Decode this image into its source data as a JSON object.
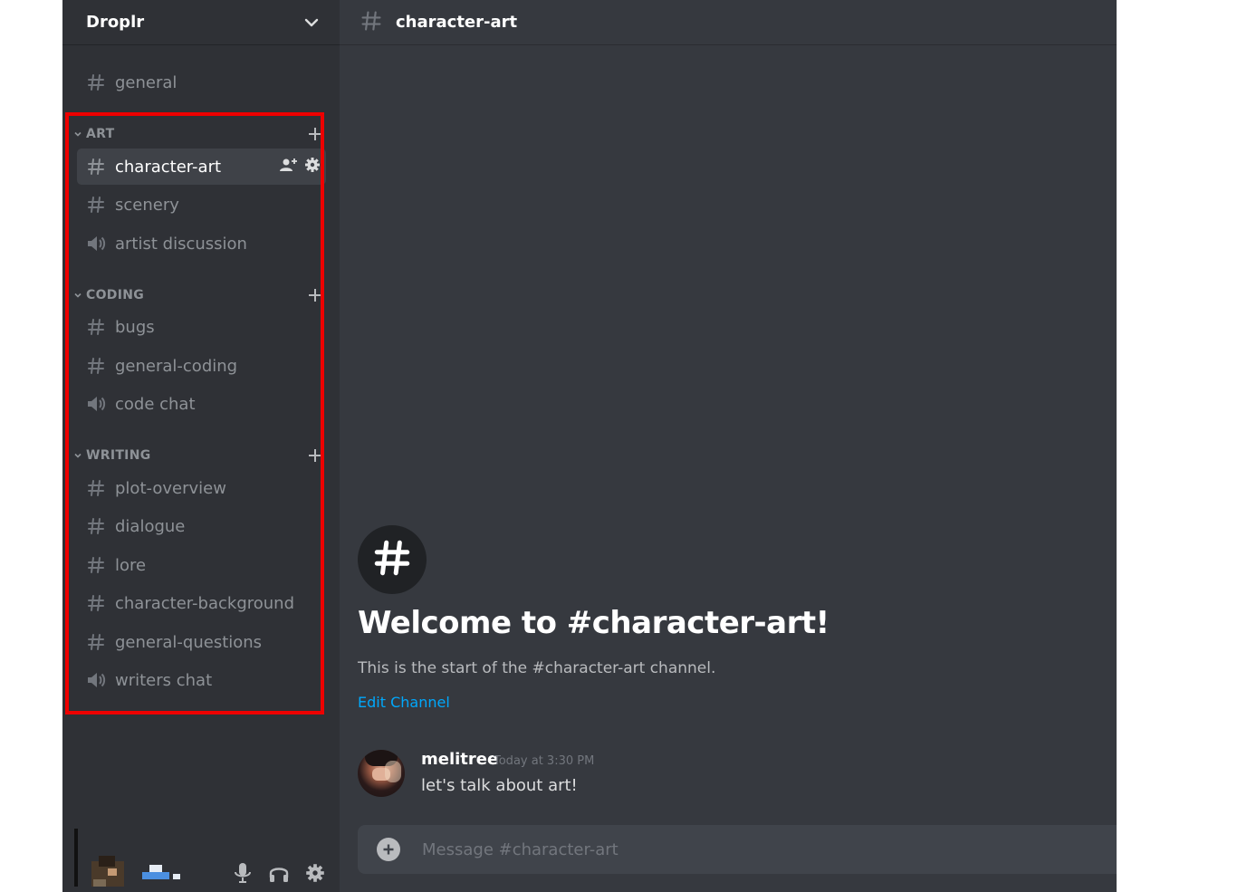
{
  "server": {
    "name": "Droplr"
  },
  "sidebar": {
    "top_channels": [
      {
        "name": "general",
        "type": "text"
      }
    ],
    "categories": [
      {
        "name": "ART",
        "channels": [
          {
            "name": "character-art",
            "type": "text",
            "active": true
          },
          {
            "name": "scenery",
            "type": "text"
          },
          {
            "name": "artist discussion",
            "type": "voice"
          }
        ]
      },
      {
        "name": "CODING",
        "channels": [
          {
            "name": "bugs",
            "type": "text"
          },
          {
            "name": "general-coding",
            "type": "text"
          },
          {
            "name": "code chat",
            "type": "voice"
          }
        ]
      },
      {
        "name": "WRITING",
        "channels": [
          {
            "name": "plot-overview",
            "type": "text"
          },
          {
            "name": "dialogue",
            "type": "text"
          },
          {
            "name": "lore",
            "type": "text"
          },
          {
            "name": "character-background",
            "type": "text"
          },
          {
            "name": "general-questions",
            "type": "text"
          },
          {
            "name": "writers chat",
            "type": "voice"
          }
        ]
      }
    ]
  },
  "header": {
    "channel_name": "character-art"
  },
  "welcome": {
    "title": "Welcome to #character-art!",
    "subtitle": "This is the start of the #character-art channel.",
    "edit_label": "Edit Channel"
  },
  "messages": [
    {
      "author": "melitree",
      "timestamp": "Today at 3:30 PM",
      "text": "let's talk about art!"
    }
  ],
  "composer": {
    "placeholder": "Message #character-art"
  },
  "colors": {
    "sidebar_bg": "#2f3136",
    "main_bg": "#36393f",
    "active_channel": "#3f4248",
    "link": "#00a8fc",
    "highlight_box": "#ee0000"
  }
}
